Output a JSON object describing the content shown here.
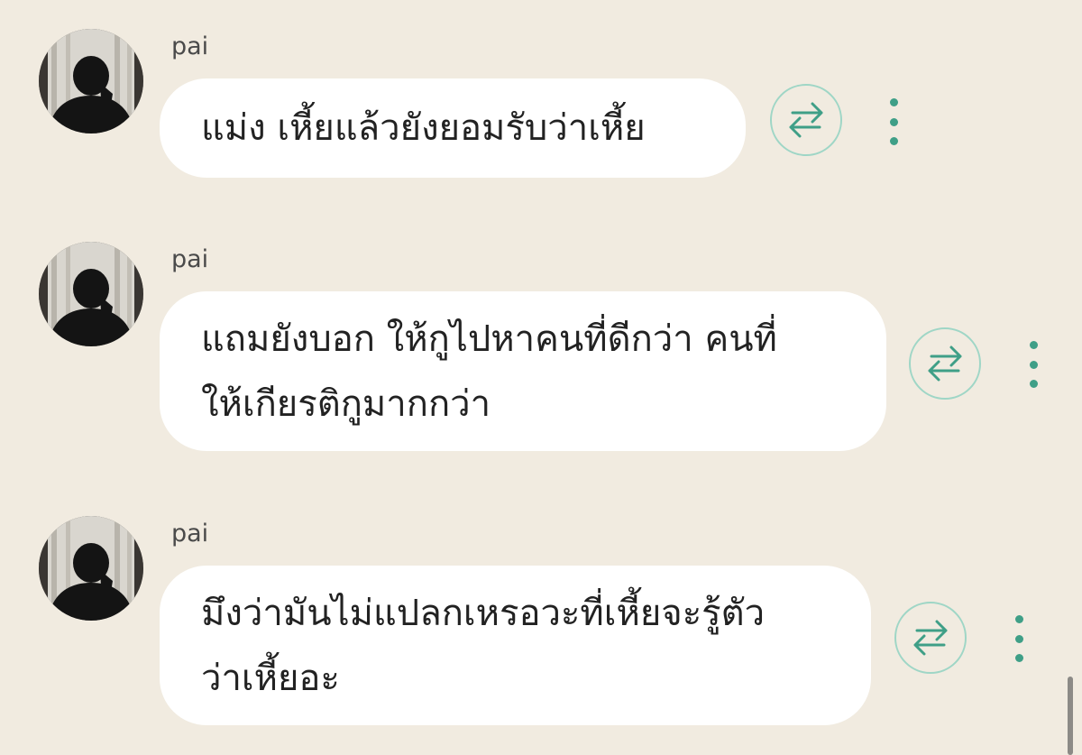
{
  "messages": [
    {
      "sender": "pai",
      "text": "แม่ง เหี้ยแล้วยังยอมรับว่าเหี้ย",
      "translate_icon": "translate-arrows-icon",
      "more_icon": "vertical-ellipsis-icon"
    },
    {
      "sender": "pai",
      "text": "แถมยังบอก ให้กูไปหาคนที่ดีกว่า คนที่\nให้เกียรติกูมากกว่า",
      "translate_icon": "translate-arrows-icon",
      "more_icon": "vertical-ellipsis-icon"
    },
    {
      "sender": "pai",
      "text": "มึงว่ามันไม่แปลกเหรอวะที่เหี้ยจะรู้ตัว\nว่าเหี้ยอะ",
      "translate_icon": "translate-arrows-icon",
      "more_icon": "vertical-ellipsis-icon"
    }
  ],
  "colors": {
    "background": "#f1ebe0",
    "bubble": "#ffffff",
    "accent": "#3f9f87",
    "translate_ring": "#9fd6c6"
  }
}
